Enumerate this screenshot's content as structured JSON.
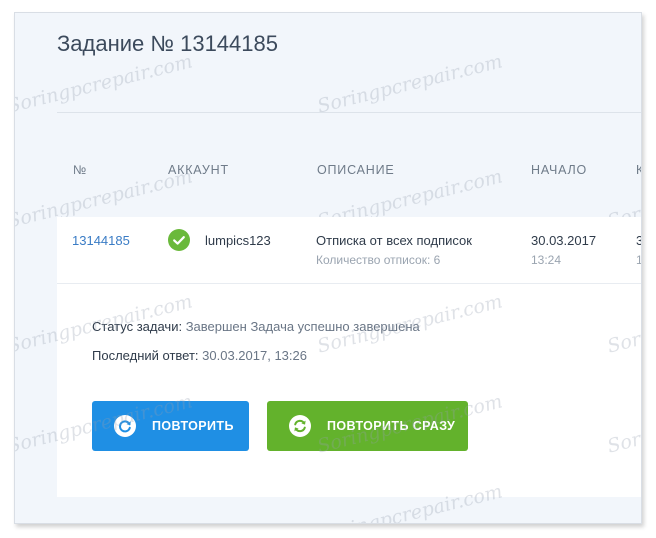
{
  "page": {
    "title": "Задание № 13144185"
  },
  "table": {
    "headers": [
      "№",
      "АККАУНТ",
      "ОПИСАНИЕ",
      "НАЧАЛО",
      "К"
    ],
    "row": {
      "id": "13144185",
      "account": "lumpics123",
      "description": "Отписка от всех подписок",
      "description_sub": "Количество отписок: 6",
      "start_date": "30.03.2017",
      "start_time": "13:24",
      "next_date_partial": "3",
      "next_time_partial": "1"
    }
  },
  "details": {
    "status_label": "Статус задачи:",
    "status_value": "Завершен Задача успешно завершена",
    "last_reply_label": "Последний ответ:",
    "last_reply_value": "30.03.2017, 13:26"
  },
  "buttons": {
    "repeat": "ПОВТОРИТЬ",
    "repeat_now": "ПОВТОРИТЬ СРАЗУ"
  },
  "watermark": "Soringpcrepair.com",
  "colors": {
    "link": "#3a7cc5",
    "success": "#6ab93b",
    "button_blue": "#1f8fe4",
    "button_green": "#63b22c"
  },
  "icons": {
    "status": "check-circle-icon",
    "repeat": "refresh-icon",
    "repeat_now": "sync-icon"
  }
}
